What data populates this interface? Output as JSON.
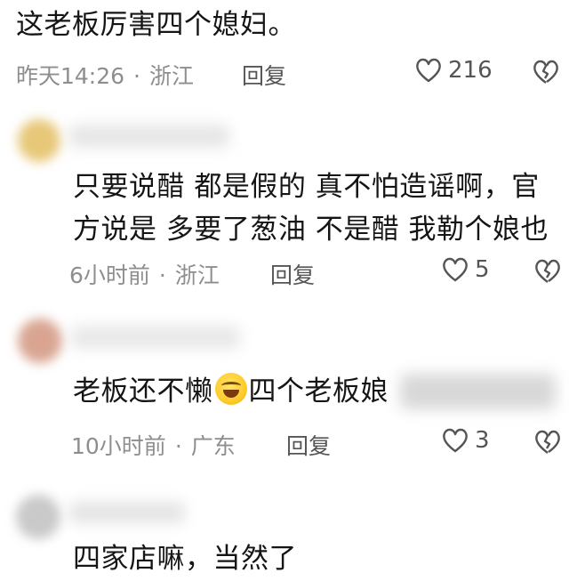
{
  "comments": [
    {
      "text": "这老板厉害四个媳妇。",
      "time": "昨天14:26",
      "location": "浙江",
      "reply_label": "回复",
      "likes": "216"
    },
    {
      "lines": [
        "只要说醋 都是假的 真不怕造谣啊，官",
        "方说是 多要了葱油 不是醋 我勒个娘也"
      ],
      "time": "6小时前",
      "location": "浙江",
      "reply_label": "回复",
      "likes": "5"
    },
    {
      "text_before": "老板还不懒",
      "text_after": "四个老板娘",
      "emoji": "laughing-tears-emoji",
      "time": "10小时前",
      "location": "广东",
      "reply_label": "回复",
      "likes": "3"
    },
    {
      "text": "四家店嘛，当然了"
    }
  ],
  "meta_separator": "·",
  "colors": {
    "text": "#151515",
    "meta": "#8e8e8e",
    "icon": "#555555"
  }
}
